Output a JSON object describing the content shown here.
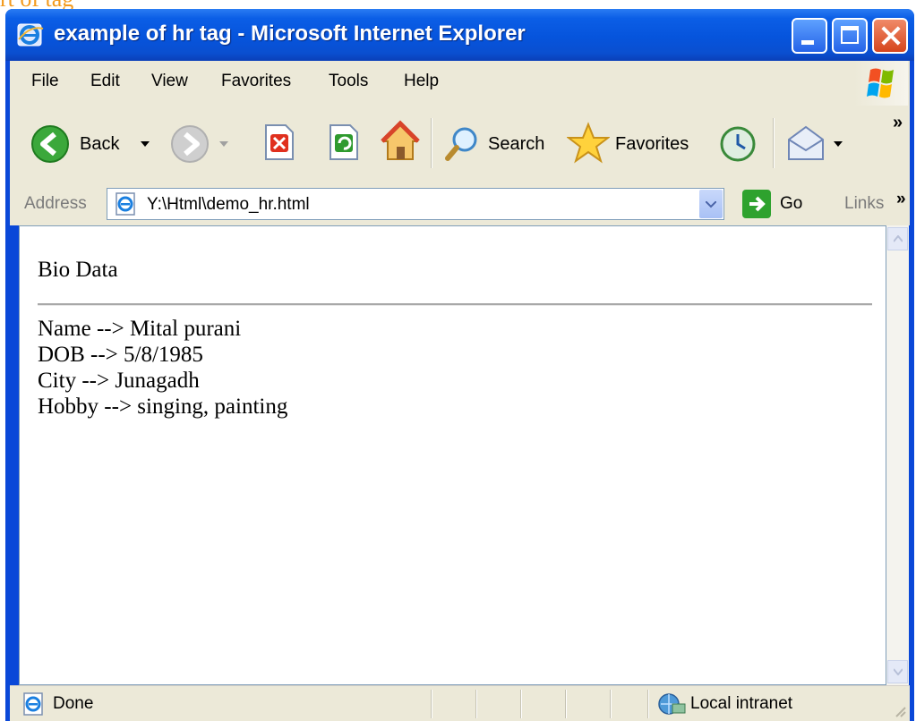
{
  "window": {
    "title": "example of hr tag - Microsoft Internet Explorer"
  },
  "background_text": "rt of tag",
  "menu": {
    "items": [
      "File",
      "Edit",
      "View",
      "Favorites",
      "Tools",
      "Help"
    ]
  },
  "toolbar": {
    "back_label": "Back",
    "search_label": "Search",
    "favorites_label": "Favorites",
    "overflow_label": "»"
  },
  "address": {
    "label": "Address",
    "url": "Y:\\Html\\demo_hr.html",
    "go_label": "Go",
    "links_label": "Links",
    "links_overflow": "»"
  },
  "page": {
    "heading": "Bio Data",
    "lines": [
      "Name --> Mital purani",
      "DOB --> 5/8/1985",
      "City --> Junagadh",
      "Hobby --> singing, painting"
    ]
  },
  "status": {
    "text": "Done",
    "zone": "Local intranet"
  },
  "colors": {
    "title_blue": "#0654dc",
    "chrome": "#ece9d8",
    "close_red": "#d6451d"
  }
}
